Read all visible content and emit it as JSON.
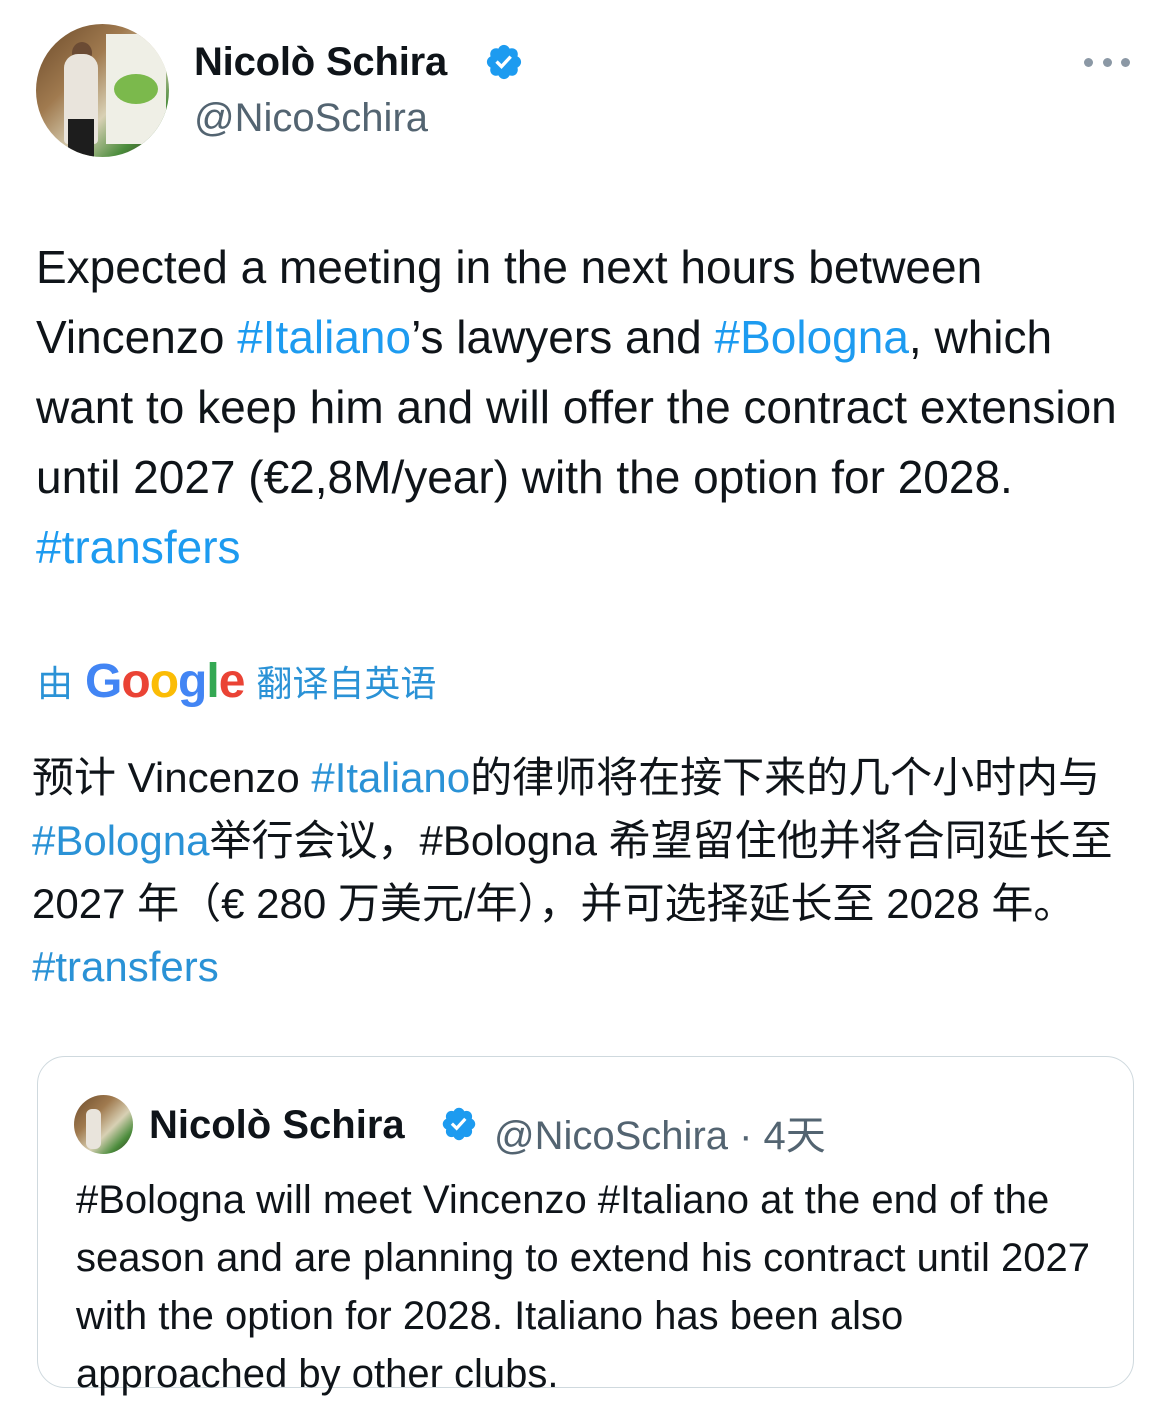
{
  "author": {
    "name": "Nicolò Schira",
    "handle": "@NicoSchira"
  },
  "tweet": {
    "seg1": "Expected a meeting in the next hours between Vincenzo ",
    "tag_italiano": "#Italiano",
    "seg2": "’s lawyers and ",
    "tag_bologna": "#Bologna",
    "seg3": ", which want to keep him and will offer the contract extension until 2027 (€2,8M/year) with the option for 2028. ",
    "tag_transfers": "#transfers"
  },
  "translation_label": {
    "prefix": "由",
    "g1": "G",
    "g2": "o",
    "g3": "o",
    "g4": "g",
    "g5": "l",
    "g6": "e",
    "suffix": "翻译自英语"
  },
  "translation": {
    "seg1": "预计 Vincenzo ",
    "tag_italiano": "#Italiano",
    "seg2": "的律师将在接下来的几个小时内与",
    "tag_bologna": "#Bologna",
    "seg3": "举行会议，#Bologna 希望留住他并将合同延长至 2027 年（€ 280 万美元/年），并可选择延长至 2028 年。 ",
    "tag_transfers": "#transfers"
  },
  "quoted": {
    "name": "Nicolò Schira",
    "handle_time": "@NicoSchira · 4天",
    "text": "#Bologna will meet Vincenzo #Italiano at the end of the season and are planning to extend his contract until 2027 with the option for 2028. Italiano has been also approached by other clubs."
  },
  "colors": {
    "link": "#1d9bf0",
    "verified": "#1d9bf0",
    "muted": "#536471"
  }
}
